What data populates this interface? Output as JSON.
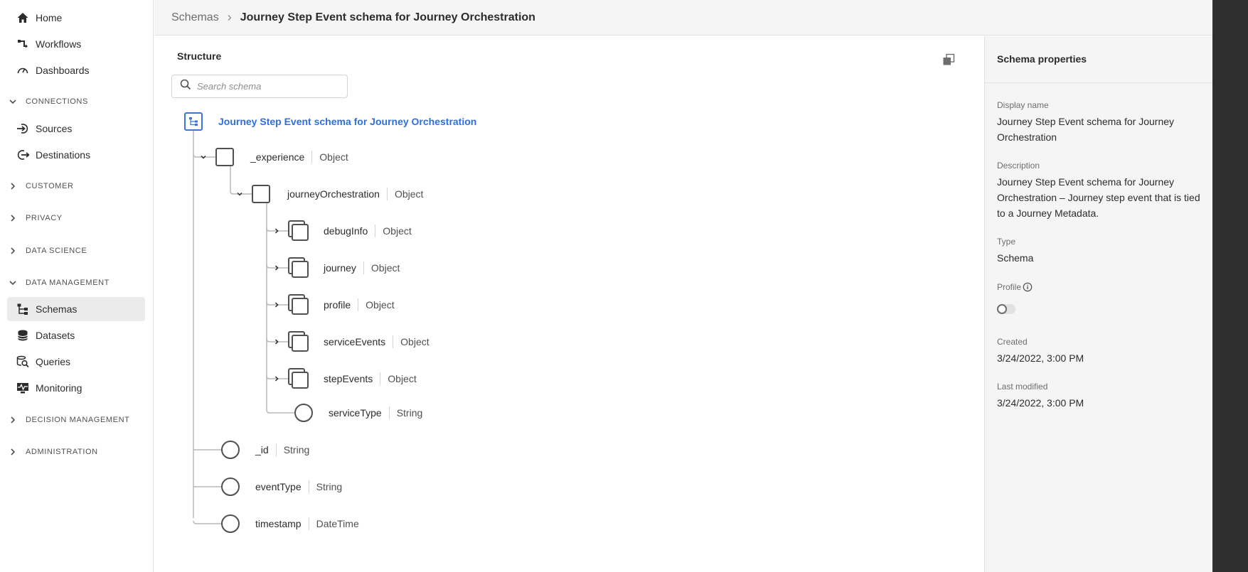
{
  "sidebar": {
    "items": [
      {
        "label": "Home",
        "icon": "home-icon"
      },
      {
        "label": "Workflows",
        "icon": "workflow-icon"
      },
      {
        "label": "Dashboards",
        "icon": "dashboard-icon"
      },
      {
        "label": "Sources",
        "icon": "sources-icon"
      },
      {
        "label": "Destinations",
        "icon": "destinations-icon"
      },
      {
        "label": "Schemas",
        "icon": "schema-icon",
        "active": true
      },
      {
        "label": "Datasets",
        "icon": "datasets-icon"
      },
      {
        "label": "Queries",
        "icon": "queries-icon"
      },
      {
        "label": "Monitoring",
        "icon": "monitoring-icon"
      }
    ],
    "sections": [
      {
        "label": "CONNECTIONS",
        "expanded": true
      },
      {
        "label": "CUSTOMER",
        "expanded": false
      },
      {
        "label": "PRIVACY",
        "expanded": false
      },
      {
        "label": "DATA SCIENCE",
        "expanded": false
      },
      {
        "label": "DATA MANAGEMENT",
        "expanded": true
      },
      {
        "label": "DECISION MANAGEMENT",
        "expanded": false
      },
      {
        "label": "ADMINISTRATION",
        "expanded": false
      }
    ]
  },
  "header": {
    "breadcrumb_root": "Schemas",
    "breadcrumb_current": "Journey Step Event schema for Journey Orchestration"
  },
  "structure": {
    "title": "Structure",
    "search_placeholder": "Search schema",
    "root_label": "Journey Step Event schema for Journey Orchestration",
    "fields": [
      {
        "name": "_experience",
        "type": "Object"
      },
      {
        "name": "journeyOrchestration",
        "type": "Object"
      },
      {
        "name": "debugInfo",
        "type": "Object"
      },
      {
        "name": "journey",
        "type": "Object"
      },
      {
        "name": "profile",
        "type": "Object"
      },
      {
        "name": "serviceEvents",
        "type": "Object"
      },
      {
        "name": "stepEvents",
        "type": "Object"
      },
      {
        "name": "serviceType",
        "type": "String"
      },
      {
        "name": "_id",
        "type": "String"
      },
      {
        "name": "eventType",
        "type": "String"
      },
      {
        "name": "timestamp",
        "type": "DateTime"
      }
    ]
  },
  "properties": {
    "title": "Schema properties",
    "display_name_label": "Display name",
    "display_name": "Journey Step Event schema for Journey Orchestration",
    "description_label": "Description",
    "description": "Journey Step Event schema for Journey Orchestration – Journey step event that is tied to a Journey Metadata.",
    "type_label": "Type",
    "type": "Schema",
    "profile_label": "Profile",
    "profile_enabled": false,
    "created_label": "Created",
    "created": "3/24/2022, 3:00 PM",
    "modified_label": "Last modified",
    "modified": "3/24/2022, 3:00 PM"
  },
  "colors": {
    "accent": "#2f6fd9",
    "panel_bg": "#f5f5f5",
    "dark_strip": "#2f2f2f"
  }
}
